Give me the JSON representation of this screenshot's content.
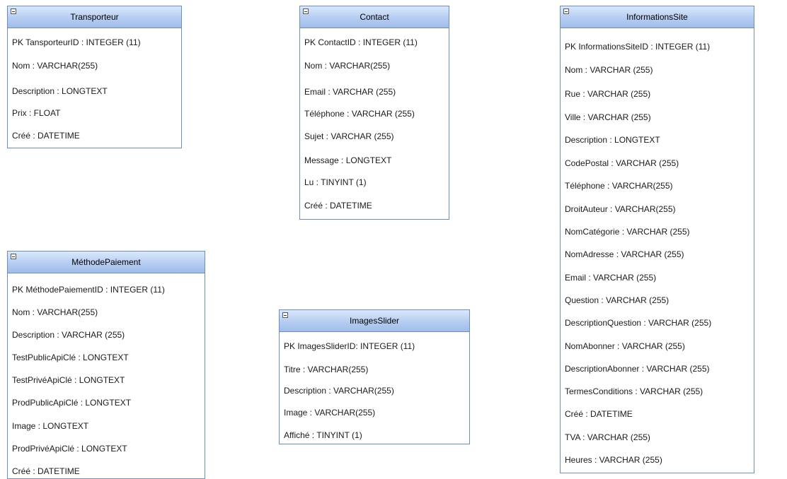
{
  "entities": [
    {
      "id": "transporteur",
      "name": "Transporteur",
      "attributes": [
        "PK  TansporteurID : INTEGER (11)",
        "Nom : VARCHAR(255)",
        "Description : LONGTEXT",
        "Prix : FLOAT",
        "Créé : DATETIME"
      ]
    },
    {
      "id": "contact",
      "name": "Contact",
      "attributes": [
        "PK  ContactID : INTEGER (11)",
        "Nom : VARCHAR(255)",
        "Email : VARCHAR (255)",
        "Téléphone : VARCHAR (255)",
        "Sujet : VARCHAR (255)",
        "Message : LONGTEXT",
        "Lu : TINYINT (1)",
        "Créé : DATETIME"
      ]
    },
    {
      "id": "informations-site",
      "name": "InformationsSite",
      "attributes": [
        "PK  InformationsSiteID : INTEGER (11)",
        "Nom : VARCHAR  (255)",
        "Rue : VARCHAR (255)",
        "Ville : VARCHAR (255)",
        "Description : LONGTEXT",
        "CodePostal : VARCHAR (255)",
        "Téléphone : VARCHAR(255)",
        "DroitAuteur : VARCHAR(255)",
        "NomCatégorie : VARCHAR (255)",
        "NomAdresse : VARCHAR (255)",
        "Email : VARCHAR (255)",
        "Question : VARCHAR (255)",
        "DescriptionQuestion : VARCHAR (255)",
        "NomAbonner : VARCHAR (255)",
        "DescriptionAbonner : VARCHAR (255)",
        "TermesConditions  : VARCHAR (255)",
        "Créé : DATETIME",
        "TVA : VARCHAR (255)",
        "Heures : VARCHAR (255)"
      ]
    },
    {
      "id": "methode-paiement",
      "name": "MéthodePaiement",
      "attributes": [
        "PK  MéthodePaiementID : INTEGER (11)",
        "Nom : VARCHAR(255)",
        "Description : VARCHAR (255)",
        "TestPublicApiClé : LONGTEXT",
        "TestPrivéApiClé : LONGTEXT",
        "ProdPublicApiClé : LONGTEXT",
        "Image : LONGTEXT",
        "ProdPrivéApiClé : LONGTEXT",
        "Créé : DATETIME"
      ]
    },
    {
      "id": "images-slider",
      "name": "ImagesSlider",
      "attributes": [
        "PK    ImagesSliderID: INTEGER (11)",
        "Titre : VARCHAR(255)",
        "Description : VARCHAR(255)",
        "Image : VARCHAR(255)",
        "Affiché : TINYINT (1)"
      ]
    }
  ]
}
